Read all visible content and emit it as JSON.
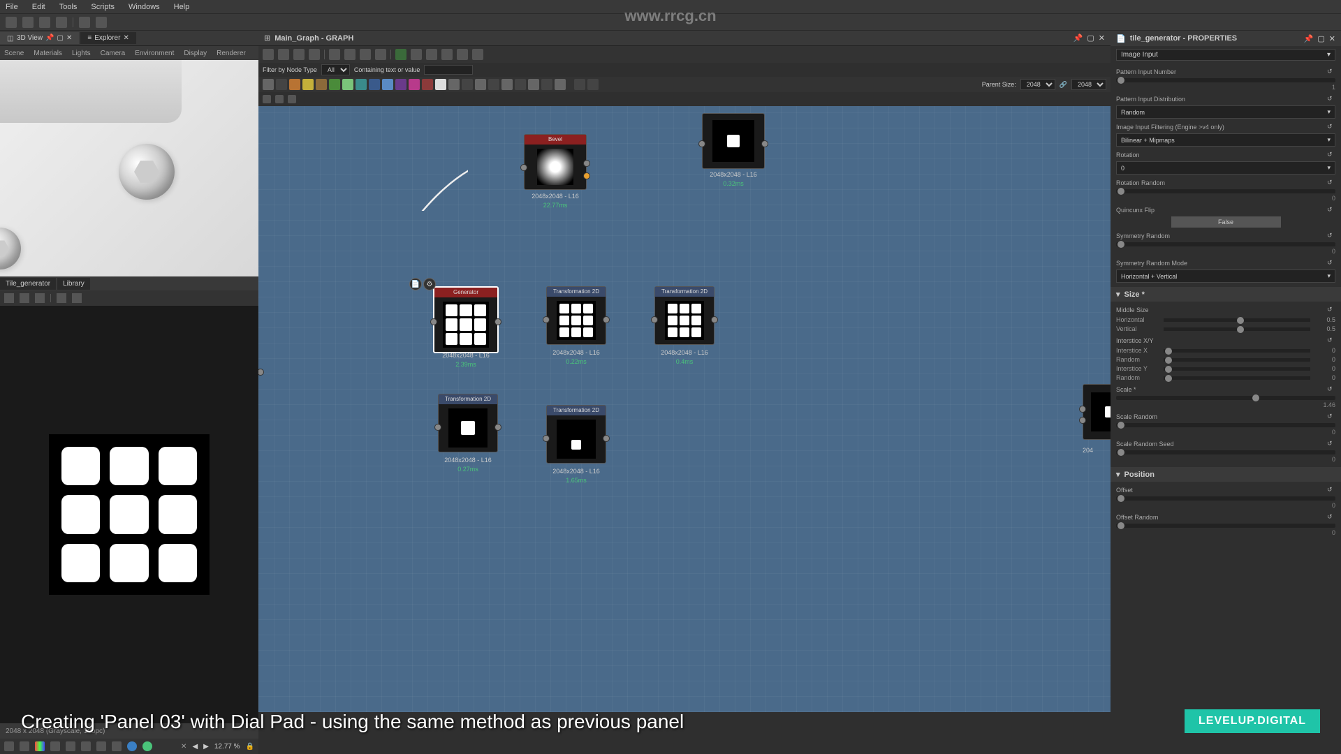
{
  "meta": {
    "watermark_url": "www.rrcg.cn"
  },
  "menu": {
    "file": "File",
    "edit": "Edit",
    "tools": "Tools",
    "scripts": "Scripts",
    "windows": "Windows",
    "help": "Help"
  },
  "left": {
    "tabs": {
      "view3d": "3D View",
      "explorer": "Explorer"
    },
    "view_tabs": {
      "scene": "Scene",
      "materials": "Materials",
      "lights": "Lights",
      "camera": "Camera",
      "environment": "Environment",
      "display": "Display",
      "renderer": "Renderer"
    },
    "preview_tabs": {
      "tilegen": "Tile_generator",
      "library": "Library"
    },
    "tile_info": "2048 x 2048 (Grayscale, 16bpc)",
    "zoom": "12.77 %"
  },
  "graph": {
    "title": "Main_Graph - GRAPH",
    "filter_label": "Filter by Node Type",
    "filter_value": "All",
    "containing_label": "Containing text or value",
    "parent_size_label": "Parent Size:",
    "parent_size_w": "2048",
    "parent_size_h": "2048",
    "nodes": {
      "bevel": {
        "title": "Bevel",
        "res": "2048x2048 - L16",
        "time": "22.77ms"
      },
      "top_right": {
        "res": "2048x2048 - L16",
        "time": "0.32ms"
      },
      "tilegen": {
        "title": "Generator",
        "res": "2048x2048 - L16",
        "time": "2.39ms"
      },
      "trans_a": {
        "title": "Transformation 2D",
        "res": "2048x2048 - L16",
        "time": "0.22ms"
      },
      "trans_b": {
        "title": "Transformation 2D",
        "res": "2048x2048 - L16",
        "time": "0.4ms"
      },
      "trans_c": {
        "title": "Transformation 2D",
        "res": "2048x2048 - L16",
        "time": "0.27ms"
      },
      "trans_d": {
        "title": "Transformation 2D",
        "res": "2048x2048 - L16",
        "time": "1.65ms"
      },
      "cut": {
        "res": "204"
      }
    }
  },
  "props": {
    "title": "tile_generator - PROPERTIES",
    "main_dropdown": "Image Input",
    "pattern_input_number": {
      "label": "Pattern Input Number",
      "value": "1"
    },
    "pattern_input_distribution": {
      "label": "Pattern Input Distribution",
      "value": "Random"
    },
    "image_input_filtering": {
      "label": "Image Input Filtering (Engine >v4 only)",
      "value": "Bilinear + Mipmaps"
    },
    "rotation": {
      "label": "Rotation",
      "value": "0"
    },
    "rotation_random": {
      "label": "Rotation Random",
      "value": "0"
    },
    "quincunx_flip": {
      "label": "Quincunx Flip",
      "value": "False"
    },
    "symmetry_random": {
      "label": "Symmetry Random",
      "value": "0"
    },
    "symmetry_random_mode": {
      "label": "Symmetry Random Mode",
      "value": "Horizontal + Vertical"
    },
    "section_size": "Size *",
    "middle_size": "Middle Size",
    "horizontal": {
      "label": "Horizontal",
      "value": "0.5"
    },
    "vertical": {
      "label": "Vertical",
      "value": "0.5"
    },
    "interstice_xy": "Interstice X/Y",
    "interstice_x": {
      "label": "Interstice X",
      "value": "0"
    },
    "random_x": {
      "label": "Random",
      "value": "0"
    },
    "interstice_y": {
      "label": "Interstice Y",
      "value": "0"
    },
    "random_y": {
      "label": "Random",
      "value": "0"
    },
    "scale": {
      "label": "Scale *",
      "value": "1.46"
    },
    "scale_random": {
      "label": "Scale Random",
      "value": "0"
    },
    "scale_random_seed": {
      "label": "Scale Random Seed",
      "value": "0"
    },
    "section_position": "Position",
    "offset": {
      "label": "Offset",
      "value": "0"
    },
    "offset_random": {
      "label": "Offset Random",
      "value": "0"
    }
  },
  "caption": {
    "text": "Creating 'Panel 03' with Dial Pad - using the same method as previous panel",
    "logo": "LEVELUP.DIGITAL"
  }
}
